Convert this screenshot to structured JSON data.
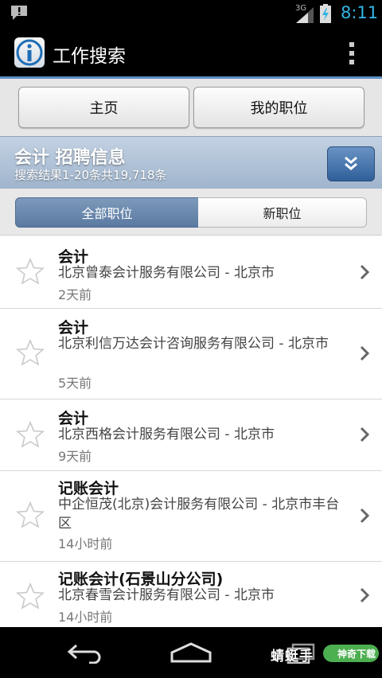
{
  "status_bar": {
    "network": "3G",
    "time": "8:11"
  },
  "app": {
    "title": "工作搜索"
  },
  "nav": {
    "home": "主页",
    "my_jobs": "我的职位"
  },
  "results": {
    "title": "会计 招聘信息",
    "summary": "搜索结果1-20条共19,718条"
  },
  "tabs": {
    "all": "全部职位",
    "new": "新职位"
  },
  "jobs": [
    {
      "title": "会计",
      "company": "北京曾泰会计服务有限公司 -  北京市",
      "age": "2天前"
    },
    {
      "title": "会计",
      "company": "北京利信万达会计咨询服务有限公司 -  北京市",
      "age": "5天前"
    },
    {
      "title": "会计",
      "company": "北京西格会计服务有限公司 -  北京市",
      "age": "9天前"
    },
    {
      "title": "记账会计",
      "company": "中企恒茂(北京)会计服务有限公司 -  北京市丰台区",
      "age": "14小时前"
    },
    {
      "title": "记账会计(石景山分公司)",
      "company": "北京春雪会计服务有限公司 -  北京市",
      "age": "14小时前"
    }
  ],
  "watermark": {
    "text": "蜻蜓手",
    "badge": "神奇下载"
  },
  "colors": {
    "accent": "#33b5e5",
    "header_blue": "#9fb4cc",
    "selected_tab": "#5b7aa1"
  }
}
